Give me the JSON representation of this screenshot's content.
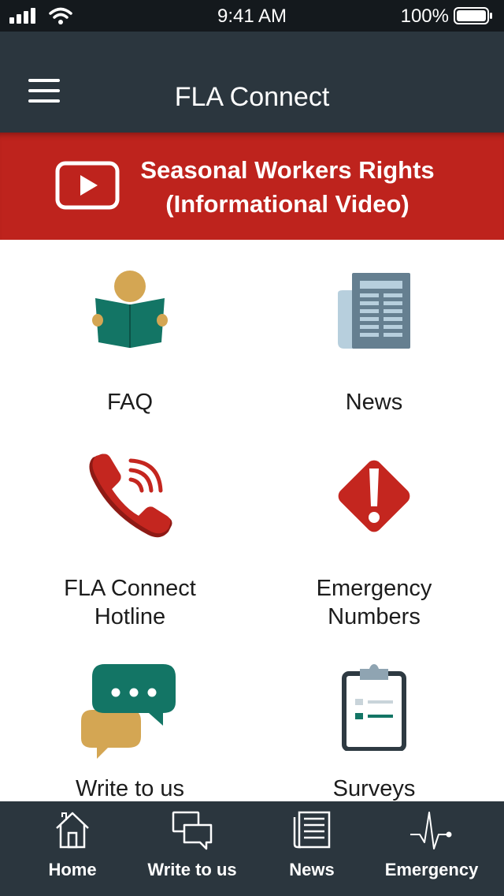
{
  "status_bar": {
    "time": "9:41 AM",
    "battery": "100%"
  },
  "nav": {
    "title": "FLA Connect",
    "menu_icon": "hamburger-menu-icon"
  },
  "banner": {
    "line1": "Seasonal Workers Rights",
    "line2": "(Informational Video)",
    "icon": "play-video-icon",
    "color": "#be231d"
  },
  "grid": [
    {
      "label": "FAQ",
      "icon": "reading-person-icon"
    },
    {
      "label": "News",
      "icon": "newspaper-icon"
    },
    {
      "label_line1": "FLA Connect",
      "label_line2": "Hotline",
      "icon": "phone-icon"
    },
    {
      "label_line1": "Emergency",
      "label_line2": "Numbers",
      "icon": "warning-icon"
    },
    {
      "label": "Write to us",
      "icon": "chat-bubbles-icon"
    },
    {
      "label": "Surveys",
      "icon": "clipboard-icon"
    }
  ],
  "tabs": [
    {
      "label": "Home",
      "icon": "home-icon"
    },
    {
      "label": "Write to us",
      "icon": "chat-outline-icon"
    },
    {
      "label": "News",
      "icon": "news-outline-icon"
    },
    {
      "label": "Emergency",
      "icon": "pulse-icon"
    }
  ],
  "colors": {
    "nav_bg": "#2b363e",
    "status_bg": "#14191d",
    "accent_red": "#be231d",
    "teal": "#137565",
    "gold": "#d4a653"
  }
}
